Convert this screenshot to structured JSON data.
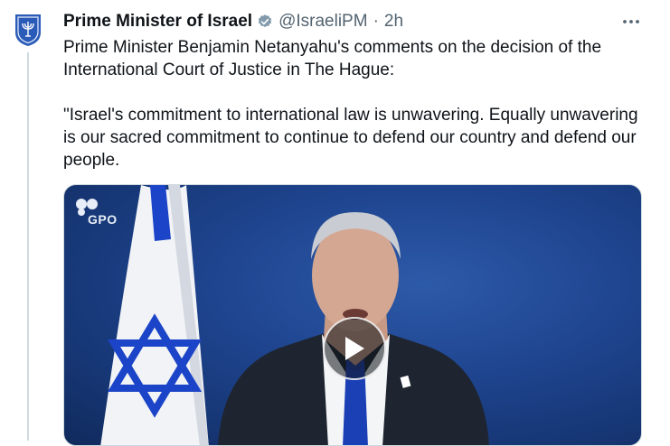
{
  "tweet": {
    "author_name": "Prime Minister of Israel",
    "handle": "@IsraeliPM",
    "separator": "·",
    "time": "2h",
    "paragraphs": [
      "Prime Minister Benjamin Netanyahu's comments on the decision of the International Court of Justice in The Hague:",
      "\"Israel's commitment to international law is unwavering. Equally unwavering is our sacred commitment to continue to defend our country and defend our people."
    ]
  },
  "media": {
    "watermark": "GPO",
    "play_icon": "play-icon"
  },
  "icons": {
    "avatar": "israel-emblem-icon",
    "verified": "verified-badge-icon",
    "more": "more-options-icon"
  },
  "colors": {
    "text_primary": "#0f1419",
    "text_secondary": "#536471",
    "verified_badge": "#829aab",
    "video_background": "#1f4590",
    "flag_blue": "#1b44c8"
  }
}
